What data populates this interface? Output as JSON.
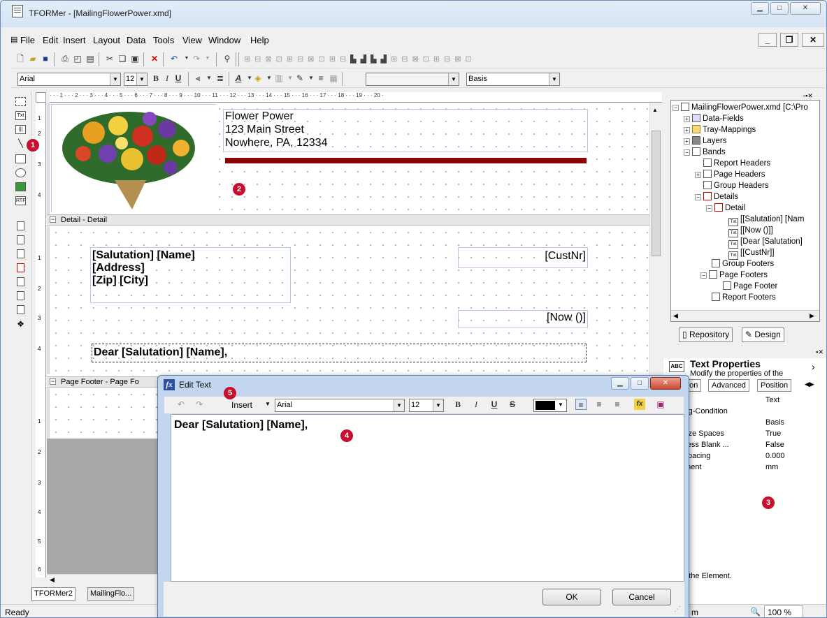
{
  "app": {
    "title": "TFORMer - [MailingFlowerPower.xmd]"
  },
  "menu": {
    "file": "File",
    "edit": "Edit",
    "insert": "Insert",
    "layout": "Layout",
    "data": "Data",
    "tools": "Tools",
    "view": "View",
    "window": "Window",
    "help": "Help"
  },
  "format": {
    "font": "Arial",
    "size": "12",
    "style": "Basis"
  },
  "header_text": {
    "line1": "Flower Power",
    "line2": "123 Main Street",
    "line3": "Nowhere, PA, 12334"
  },
  "bands": {
    "detail": "Detail - Detail",
    "footer": "Page Footer - Page Fo"
  },
  "fields": {
    "address1": "[Salutation] [Name]",
    "address2": "[Address]",
    "address3": "[Zip] [City]",
    "custnr": "[CustNr]",
    "now": "[Now ()]",
    "dear": "Dear [Salutation] [Name],"
  },
  "ruler": {
    "h": "· · · 1 · · · 2 · · · 3 · · · 4 · · · 5 · · · 6 · · · 7 · · · 8 · · · 9 · · · 10 · · · 11 · · · 12 · · · 13 · · · 14 · · · 15 · · · 16 · · · 17 · · · 18 · · · 19 · · · 20 ·"
  },
  "tree": {
    "root": "MailingFlowerPower.xmd [C:\\Pro",
    "datafields": "Data-Fields",
    "traymappings": "Tray-Mappings",
    "layers": "Layers",
    "bands": "Bands",
    "reportheaders": "Report Headers",
    "pageheaders": "Page Headers",
    "groupheaders": "Group Headers",
    "details": "Details",
    "detail": "Detail",
    "f1": "[[Salutation] [Nam",
    "f2": "[[Now ()]]",
    "f3": "[Dear [Salutation]",
    "f4": "[[CustNr]]",
    "groupfooters": "Group Footers",
    "pagefooters": "Page Footers",
    "pagefooter": "Page Footer",
    "reportfooters": "Report Footers"
  },
  "rtabs": {
    "repository": "Repository",
    "design": "Design"
  },
  "props": {
    "title": "Text Properties",
    "subtitle": "Modify the properties of the",
    "tab_common": "mon",
    "tab_advanced": "Advanced",
    "tab_position": "Position",
    "rows": [
      {
        "name": "ne",
        "value": "Text"
      },
      {
        "name": "ting-Condition",
        "value": ""
      },
      {
        "name": "er",
        "value": "Basis"
      },
      {
        "name": "mize Spaces",
        "value": "True"
      },
      {
        "name": "press Blank ...",
        "value": "False"
      },
      {
        "name": "-Spacing",
        "value": "0.000 mm"
      },
      {
        "name": "nment",
        "value": ""
      }
    ],
    "desc_title": "e:",
    "desc": "of the Element."
  },
  "dialog": {
    "title": "Edit Text",
    "insert": "Insert",
    "font": "Arial",
    "size": "12",
    "content": "Dear [Salutation] [Name],",
    "ok": "OK",
    "cancel": "Cancel"
  },
  "doctabs": {
    "t1": "TFORMer2",
    "t2": "MailingFlo..."
  },
  "status": {
    "left": "Ready",
    "zoom": "100 %",
    "m": "m"
  },
  "badges": {
    "b1": "1",
    "b2": "2",
    "b3": "3",
    "b4": "4",
    "b5": "5"
  }
}
